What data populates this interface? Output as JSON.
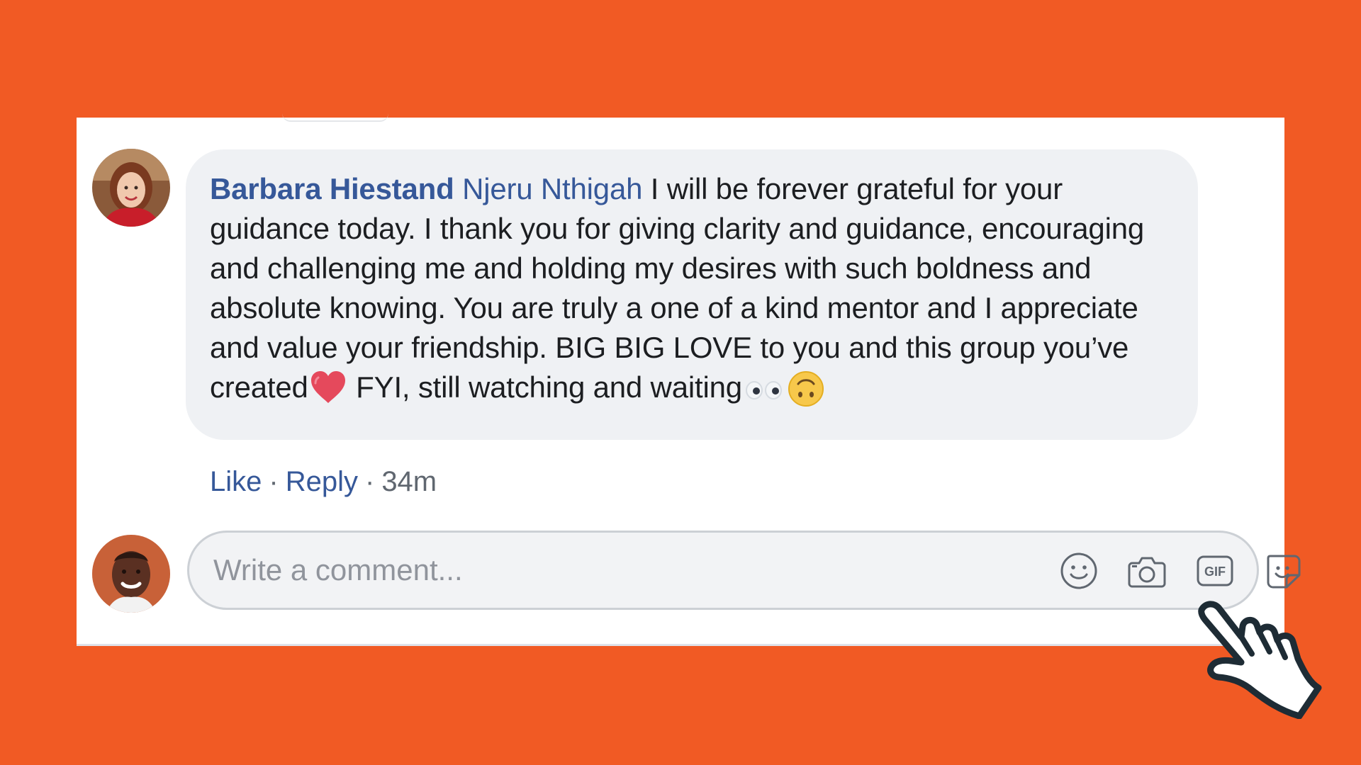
{
  "comment": {
    "author": "Barbara Hiestand",
    "mention": "Njeru Nthigah",
    "text_part1": " I will be forever grateful for your guidance today. I thank you for giving clarity and guidance, encouraging and challenging me and holding my desires with such boldness and absolute knowing. You are truly a one of a kind mentor and I appreciate and value your friendship. BIG BIG LOVE to you and this group you’ve created",
    "text_part2": " FYI, still watching and waiting",
    "emojis": [
      "red-heart",
      "eyes",
      "upside-down-face"
    ]
  },
  "actions": {
    "like": "Like",
    "reply": "Reply",
    "separator": "·",
    "time": "34m"
  },
  "composer": {
    "placeholder": "Write a comment...",
    "tools": [
      "emoji-icon",
      "camera-icon",
      "gif-icon",
      "sticker-icon"
    ]
  },
  "colors": {
    "background": "#f15a24",
    "link": "#365899",
    "bubble": "#eff1f4",
    "text": "#1c1e21",
    "muted": "#606770"
  }
}
